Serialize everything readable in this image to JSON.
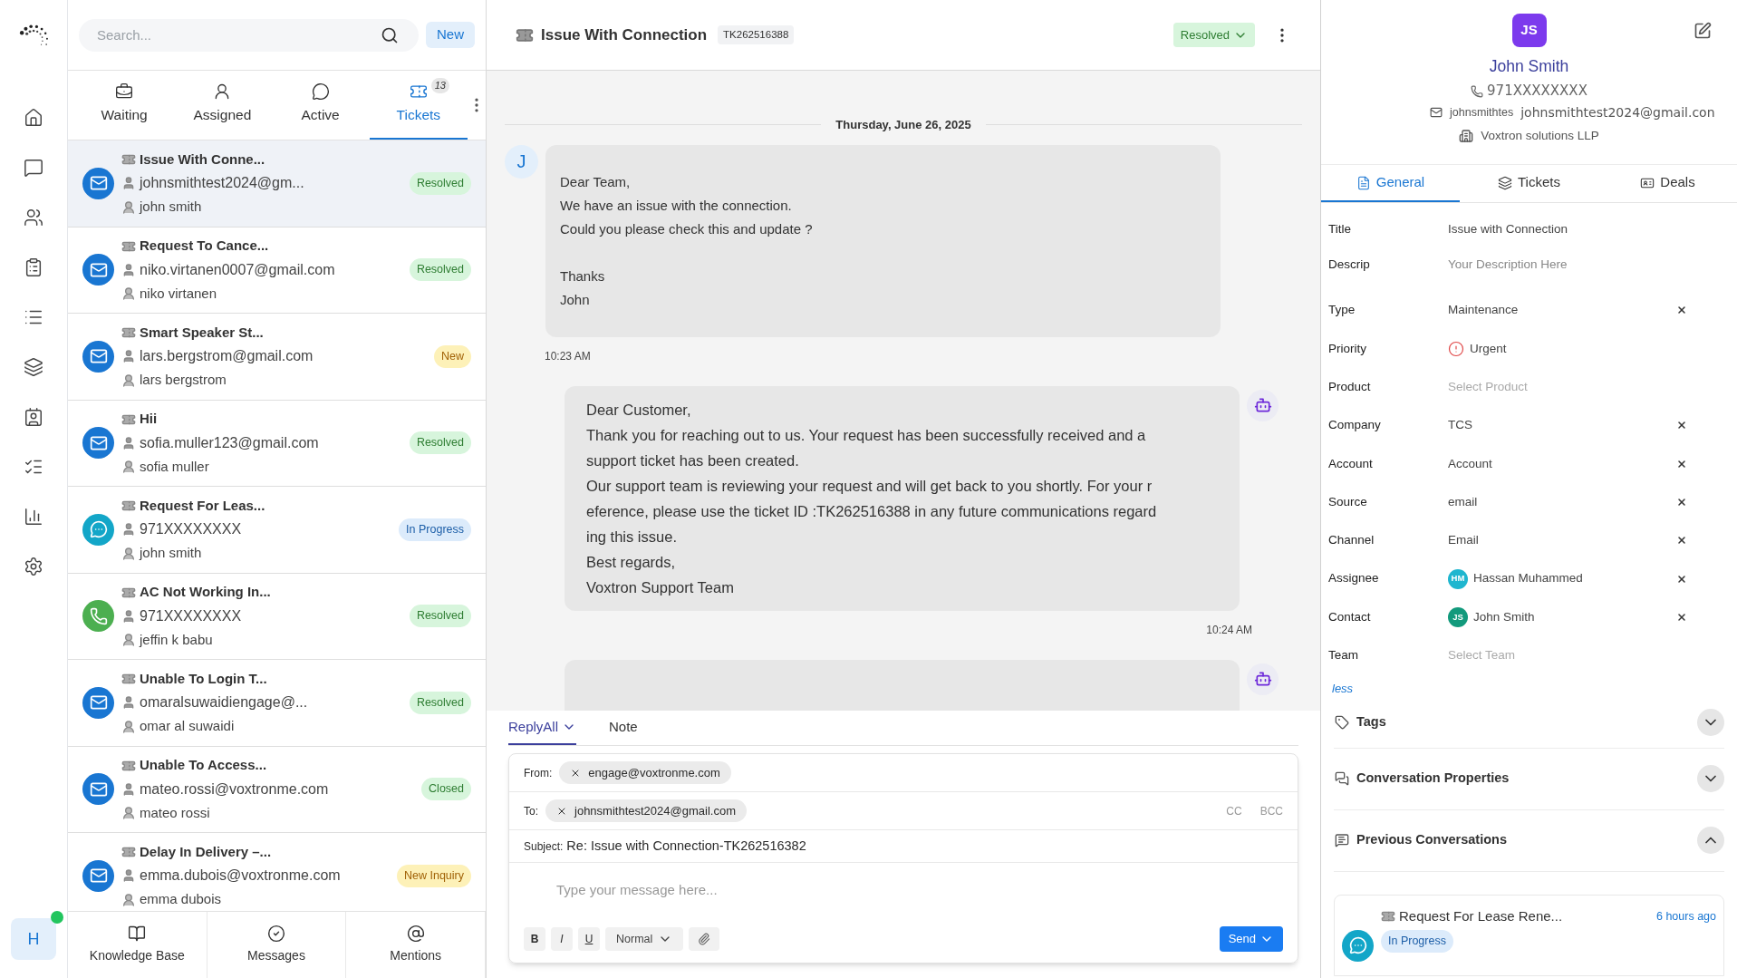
{
  "user": {
    "initial": "H",
    "online": true
  },
  "search": {
    "placeholder": "Search..."
  },
  "new_button": "New",
  "tabs": [
    {
      "label": "Waiting",
      "selected": false
    },
    {
      "label": "Assigned",
      "selected": false
    },
    {
      "label": "Active",
      "selected": false
    },
    {
      "label": "Tickets",
      "selected": true,
      "badge": "13"
    }
  ],
  "tickets": [
    {
      "title": "Issue With Conne...",
      "contact": "johnsmithtest2024@gm...",
      "agent": "john smith",
      "status": "Resolved",
      "color": "#d7f5dc",
      "kind": "email",
      "selected": true
    },
    {
      "title": "Request To Cance...",
      "contact": "niko.virtanen0007@gmail.com",
      "agent": "niko virtanen",
      "status": "Resolved",
      "color": "#d7f5dc",
      "kind": "email",
      "selected": false
    },
    {
      "title": "Smart Speaker St...",
      "contact": "lars.bergstrom@gmail.com",
      "agent": "lars bergstrom",
      "status": "New",
      "color": "#fdf1b8",
      "kind": "email",
      "selected": false
    },
    {
      "title": "Hii",
      "contact": "sofia.muller123@gmail.com",
      "agent": "sofia muller",
      "status": "Resolved",
      "color": "#d7f5dc",
      "kind": "email",
      "selected": false
    },
    {
      "title": "Request For Leas...",
      "contact": "971XXXXXXXX",
      "agent": "john smith",
      "status": "In Progress",
      "color": "#dcebfb",
      "kind": "chat",
      "selected": false
    },
    {
      "title": "AC Not Working In...",
      "contact": "971XXXXXXXX",
      "agent": "jeffin k babu",
      "status": "Resolved",
      "color": "#d7f5dc",
      "kind": "whatsapp",
      "selected": false
    },
    {
      "title": "Unable To Login T...",
      "contact": "omaralsuwaidiengage@...",
      "agent": "omar al suwaidi",
      "status": "Resolved",
      "color": "#d7f5dc",
      "kind": "email",
      "selected": false
    },
    {
      "title": "Unable To Access...",
      "contact": "mateo.rossi@voxtronme.com",
      "agent": "mateo rossi",
      "status": "Closed",
      "color": "#d7f5dc",
      "kind": "email",
      "selected": false
    },
    {
      "title": "Delay In Delivery –...",
      "contact": "emma.dubois@voxtronme.com",
      "agent": "emma dubois",
      "status": "New Inquiry",
      "color": "#fdf1b8",
      "kind": "email",
      "selected": false
    }
  ],
  "bottom_nav": [
    {
      "label": "Knowledge Base"
    },
    {
      "label": "Messages"
    },
    {
      "label": "Mentions"
    }
  ],
  "conversation": {
    "title": "Issue With Connection",
    "ticket_id": "TK262516388",
    "status": "Resolved",
    "date": "Thursday, June 26, 2025",
    "messages": [
      {
        "kind": "incoming",
        "avatar": "J",
        "paragraphs": [
          [
            "Dear Team,",
            "We have an issue with the connection.",
            "Could you please check this and update ?"
          ],
          [
            "Thanks",
            "John"
          ]
        ],
        "time": "10:23 AM"
      },
      {
        "kind": "outgoing",
        "paragraphs": [
          [
            "Dear Customer,",
            "Thank you for reaching out to us. Your request has been successfully received and a",
            "support ticket has been created.",
            "Our support team is reviewing your request and will get back to you shortly. For your r",
            "eference, please use the ticket ID :TK262516388 in any future communications regard",
            "ing this issue.",
            "Best regards,",
            "Voxtron Support Team"
          ]
        ],
        "time": "10:24 AM"
      },
      {
        "kind": "outgoing"
      }
    ]
  },
  "composer": {
    "tabs": [
      {
        "label": "ReplyAll",
        "selected": true,
        "dropdown": true
      },
      {
        "label": "Note",
        "selected": false,
        "dropdown": false
      }
    ],
    "from_label": "From:",
    "from": "engage@voxtronme.com",
    "to_label": "To:",
    "to": "johnsmithtest2024@gmail.com",
    "cc": "CC",
    "bcc": "BCC",
    "subject_label": "Subject:",
    "subject": "Re: Issue with Connection-TK262516382",
    "placeholder": "Type your message here...",
    "tools": [
      "B",
      "I",
      "U"
    ],
    "format": "Normal",
    "send": "Send"
  },
  "contact": {
    "initials": "JS",
    "name": "John Smith",
    "phone": "971XXXXXXXX",
    "email": "johnsmithtes",
    "email_tooltip": "johnsmithtest2024@gmail.con",
    "company": "Voxtron solutions LLP"
  },
  "detail_tabs": [
    {
      "label": "General",
      "selected": true
    },
    {
      "label": "Tickets",
      "selected": false
    },
    {
      "label": "Deals",
      "selected": false
    }
  ],
  "fields": [
    {
      "label": "Title",
      "kind": "text",
      "value": "Issue with Connection",
      "clearable": false
    },
    {
      "label": "Descrip",
      "kind": "textarea",
      "placeholder": "Your Description Here",
      "clearable": false
    },
    {
      "label": "Type",
      "kind": "text",
      "value": "Maintenance",
      "clearable": true
    },
    {
      "label": "Priority",
      "kind": "priority",
      "value": "Urgent",
      "clearable": false
    },
    {
      "label": "Product",
      "kind": "text",
      "placeholder": "Select Product",
      "clearable": false
    },
    {
      "label": "Company",
      "kind": "text",
      "value": "TCS",
      "clearable": true
    },
    {
      "label": "Account",
      "kind": "text",
      "value": "Account",
      "clearable": true
    },
    {
      "label": "Source",
      "kind": "text",
      "value": "email",
      "clearable": true
    },
    {
      "label": "Channel",
      "kind": "text",
      "value": "Email",
      "clearable": true
    },
    {
      "label": "Assignee",
      "kind": "person",
      "value": "Hassan Muhammed",
      "avatar": "HM",
      "color": "#1fb6cf",
      "clearable": true
    },
    {
      "label": "Contact",
      "kind": "person",
      "value": "John Smith",
      "avatar": "JS",
      "color": "#129a7c",
      "clearable": true
    },
    {
      "label": "Team",
      "kind": "text",
      "placeholder": "Select Team",
      "clearable": false
    }
  ],
  "less_link": "less",
  "sections": [
    {
      "title": "Tags",
      "expanded": false
    },
    {
      "title": "Conversation Properties",
      "expanded": false
    },
    {
      "title": "Previous Conversations",
      "expanded": true
    }
  ],
  "previous": {
    "title": "Request For Lease Rene...",
    "time": "6 hours ago",
    "status": "In Progress",
    "color": "#dcebfb",
    "kind": "chat"
  }
}
